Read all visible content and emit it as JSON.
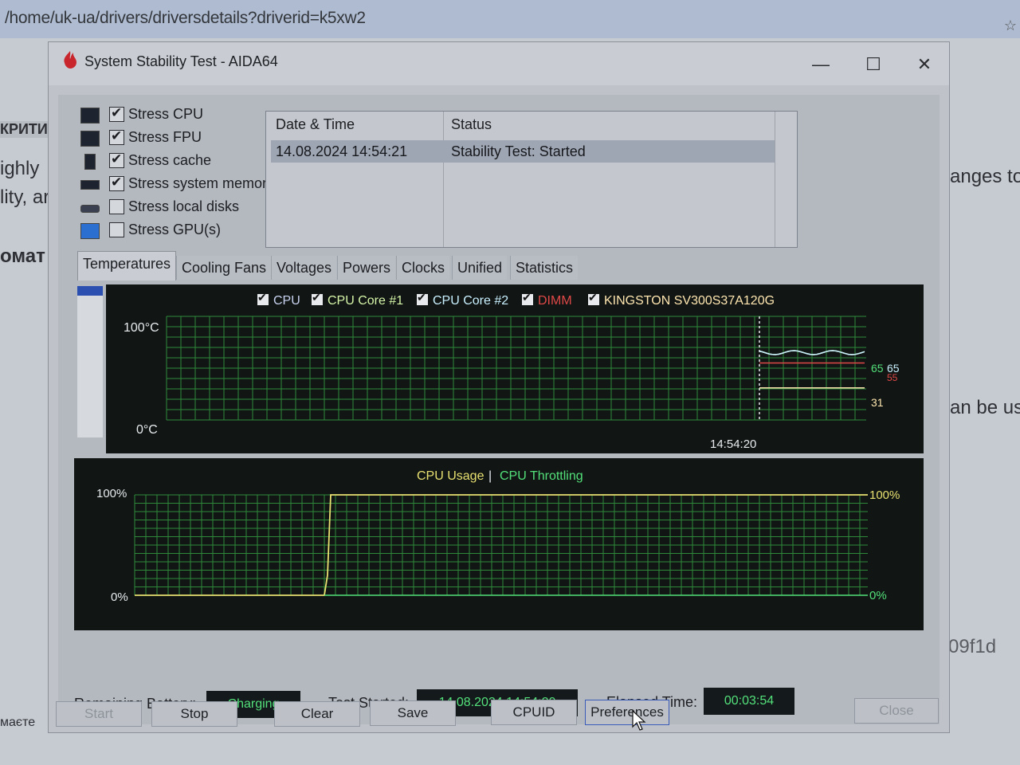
{
  "browser": {
    "url": "/home/uk-ua/drivers/driversdetails?driverid=k5xw2",
    "left_fragments": [
      "КРИТИ",
      "ighly",
      "lity, ar",
      "омат",
      "маєте"
    ],
    "right_fragments": [
      "anges to",
      "an be us",
      "09f1d"
    ]
  },
  "window": {
    "title": "System Stability Test - AIDA64",
    "controls": {
      "minimize": "—",
      "maximize": "☐",
      "close": "✕"
    }
  },
  "stress": [
    {
      "label": "Stress CPU",
      "checked": true,
      "icon": "cpu-icon"
    },
    {
      "label": "Stress FPU",
      "checked": true,
      "icon": "fpu-icon"
    },
    {
      "label": "Stress cache",
      "checked": true,
      "icon": "cache-icon"
    },
    {
      "label": "Stress system memory",
      "checked": true,
      "icon": "memory-icon"
    },
    {
      "label": "Stress local disks",
      "checked": false,
      "icon": "disk-icon"
    },
    {
      "label": "Stress GPU(s)",
      "checked": false,
      "icon": "monitor-icon"
    }
  ],
  "log": {
    "columns": [
      "Date & Time",
      "Status"
    ],
    "rows": [
      {
        "datetime": "14.08.2024 14:54:21",
        "status": "Stability Test: Started"
      }
    ]
  },
  "tabs": [
    "Temperatures",
    "Cooling Fans",
    "Voltages",
    "Powers",
    "Clocks",
    "Unified",
    "Statistics"
  ],
  "active_tab": "Temperatures",
  "temperature_graph": {
    "legend": [
      {
        "label": "CPU",
        "color": "#c8d2f0"
      },
      {
        "label": "CPU Core #1",
        "color": "#d6f5a8"
      },
      {
        "label": "CPU Core #2",
        "color": "#c9f0ff"
      },
      {
        "label": "DIMM",
        "color": "#e04848"
      },
      {
        "label": "KINGSTON SV300S37A120G",
        "color": "#ffe6b0"
      }
    ],
    "y_max_label": "100°C",
    "y_min_label": "0°C",
    "time_label": "14:54:20",
    "values_shown": [
      "65",
      "65",
      "55",
      "31"
    ],
    "y_range": [
      0,
      100
    ],
    "readings": {
      "cpu": 65,
      "core1": 65,
      "dimm": 55,
      "ssd": 31
    }
  },
  "usage_graph": {
    "title_usage": "CPU Usage",
    "separator": "|",
    "title_throttling": "CPU Throttling",
    "left_max": "100%",
    "left_min": "0%",
    "right_max": "100%",
    "right_min": "0%",
    "usage_color": "#e8e070",
    "throttle_color": "#53e07a",
    "cpu_usage_percent": 100,
    "throttling_percent": 0
  },
  "status": {
    "battery_label": "Remaining Battery:",
    "battery_value": "Charging",
    "started_label": "Test Started:",
    "started_value": "14.08.2024 14:54:20",
    "elapsed_label": "Elapsed Time:",
    "elapsed_value": "00:03:54"
  },
  "buttons": {
    "start": "Start",
    "stop": "Stop",
    "clear": "Clear",
    "save": "Save",
    "cpuid": "CPUID",
    "preferences": "Preferences",
    "close": "Close"
  },
  "colors": {
    "grid": "#2e8a3a",
    "graph_bg": "#111614",
    "status_text": "#53e07a",
    "selected_row": "#9fa6b3"
  }
}
